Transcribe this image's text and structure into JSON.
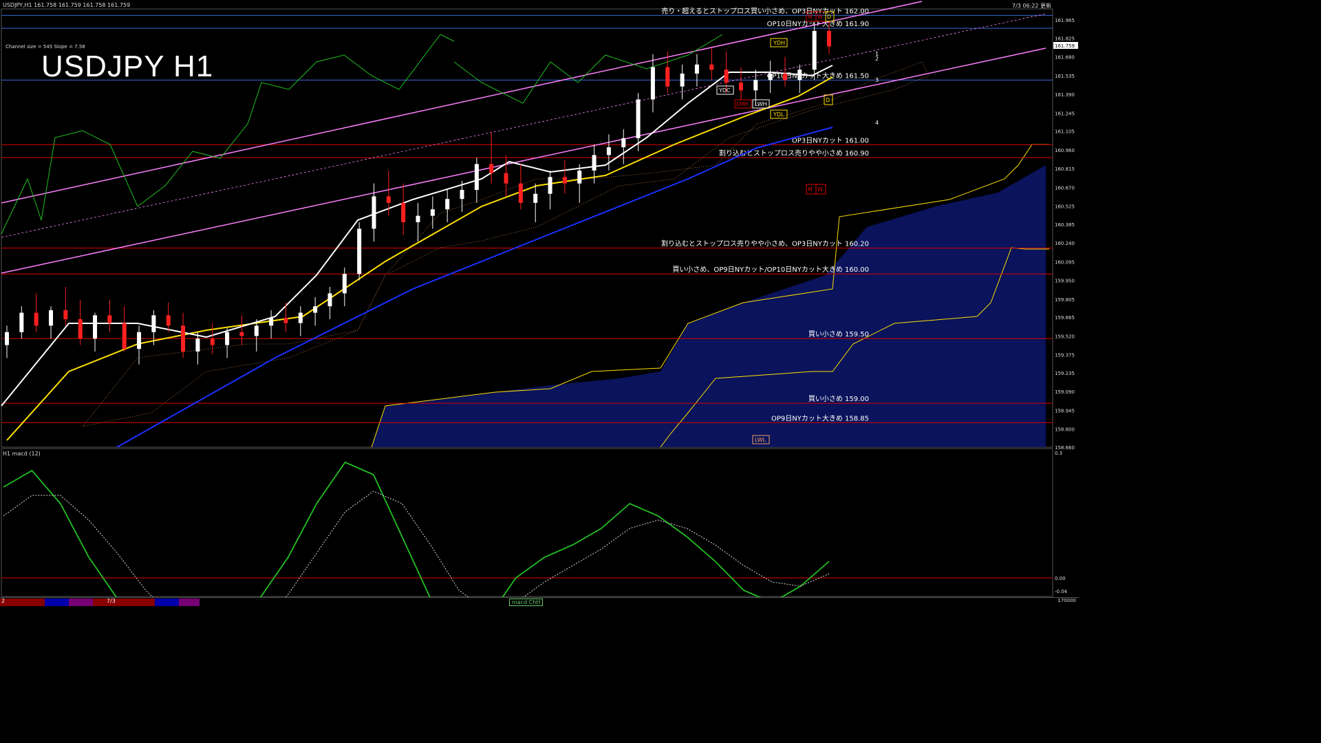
{
  "header": {
    "symbol_info": "USDJPY,H1  161.758 161.759 161.758 161.759",
    "time": "7/3 06:22 更新",
    "title": "USDJPY H1",
    "channel_info": "Channel size = 545 Slope = 7.58"
  },
  "macd_panel": {
    "label": "H1  macd (12)",
    "ticks": [
      "0.3",
      "0.00",
      "-0.04"
    ]
  },
  "footer": {
    "left": "2",
    "date": "7/3",
    "tab": "macd ChH",
    "right": "170000"
  },
  "price_scale": {
    "min": 158.66,
    "max": 162.05,
    "ticks": [
      "161.965",
      "161.825",
      "161.680",
      "161.535",
      "161.390",
      "161.245",
      "161.105",
      "160.960",
      "160.815",
      "160.670",
      "160.525",
      "160.385",
      "160.240",
      "160.095",
      "159.950",
      "159.805",
      "159.665",
      "159.520",
      "159.375",
      "159.235",
      "159.090",
      "158.945",
      "158.800",
      "158.660"
    ],
    "current": "161.759"
  },
  "levels": [
    {
      "price": 162.0,
      "text": "売り・超えるとストップロス買い小さめ、OP3日NYカット 162.00",
      "color": "#3a6ad8"
    },
    {
      "price": 161.9,
      "text": "OP10日NYカット大きめ 161.90",
      "color": "#3a6ad8"
    },
    {
      "price": 161.5,
      "text": "OP10日NYカット大きめ 161.50",
      "color": "#3a6ad8"
    },
    {
      "price": 161.0,
      "text": "OP3日NYカット 161.00",
      "color": "#d00"
    },
    {
      "price": 160.9,
      "text": "割り込むとストップロス売りやや小さめ 160.90",
      "color": "#d00"
    },
    {
      "price": 160.2,
      "text": "割り込むとストップロス売りやや小さめ、OP3日NYカット 160.20",
      "color": "#d00"
    },
    {
      "price": 160.0,
      "text": "買い小さめ、OP9日NYカット/OP10日NYカット大きめ 160.00",
      "color": "#d00"
    },
    {
      "price": 159.5,
      "text": "買い小さめ 159.50",
      "color": "#d00"
    },
    {
      "price": 159.0,
      "text": "買い小さめ 159.00",
      "color": "#d00"
    },
    {
      "price": 158.85,
      "text": "OP9日NYカット大きめ 158.85",
      "color": "#d00"
    }
  ],
  "markers": [
    "YDH",
    "YDC",
    "YDL",
    "LWH",
    "LMH",
    "LWL",
    "M",
    "W",
    "D"
  ],
  "channel_numbers": [
    "1",
    "2",
    "3",
    "4"
  ],
  "colors": {
    "bull": "#ffffff",
    "bear": "#ff2020",
    "tenkan": "#ffffff",
    "sma": "#ffe000",
    "long_ma": "#1a30ff",
    "lagging": "#22c022",
    "channel": "#ff80ff",
    "kumo_blue": "#1a28a0",
    "kumo_orange": "#f0a060",
    "macd_up": "#22c022",
    "macd_down": "#ff8fb0",
    "signal": "#dddddd"
  },
  "chart_data": {
    "type": "candlestick",
    "title": "USDJPY H1",
    "ylim": [
      158.66,
      162.05
    ],
    "candles": [
      [
        159.45,
        159.6,
        159.35,
        159.55
      ],
      [
        159.55,
        159.75,
        159.5,
        159.7
      ],
      [
        159.7,
        159.85,
        159.55,
        159.6
      ],
      [
        159.6,
        159.75,
        159.5,
        159.72
      ],
      [
        159.72,
        159.9,
        159.6,
        159.65
      ],
      [
        159.65,
        159.8,
        159.45,
        159.5
      ],
      [
        159.5,
        159.7,
        159.4,
        159.68
      ],
      [
        159.68,
        159.8,
        159.55,
        159.62
      ],
      [
        159.62,
        159.75,
        159.4,
        159.42
      ],
      [
        159.42,
        159.6,
        159.3,
        159.55
      ],
      [
        159.55,
        159.72,
        159.45,
        159.68
      ],
      [
        159.68,
        159.78,
        159.55,
        159.6
      ],
      [
        159.6,
        159.7,
        159.35,
        159.4
      ],
      [
        159.4,
        159.55,
        159.3,
        159.5
      ],
      [
        159.5,
        159.62,
        159.38,
        159.45
      ],
      [
        159.45,
        159.58,
        159.35,
        159.55
      ],
      [
        159.55,
        159.68,
        159.45,
        159.52
      ],
      [
        159.52,
        159.65,
        159.4,
        159.6
      ],
      [
        159.6,
        159.72,
        159.5,
        159.66
      ],
      [
        159.66,
        159.78,
        159.55,
        159.62
      ],
      [
        159.62,
        159.75,
        159.52,
        159.7
      ],
      [
        159.7,
        159.82,
        159.6,
        159.75
      ],
      [
        159.75,
        159.9,
        159.65,
        159.85
      ],
      [
        159.85,
        160.05,
        159.75,
        160.0
      ],
      [
        160.0,
        160.4,
        159.95,
        160.35
      ],
      [
        160.35,
        160.7,
        160.25,
        160.6
      ],
      [
        160.6,
        160.8,
        160.45,
        160.55
      ],
      [
        160.55,
        160.7,
        160.3,
        160.4
      ],
      [
        160.4,
        160.55,
        160.25,
        160.45
      ],
      [
        160.45,
        160.6,
        160.35,
        160.5
      ],
      [
        160.5,
        160.65,
        160.4,
        160.58
      ],
      [
        160.58,
        160.72,
        160.48,
        160.65
      ],
      [
        160.65,
        160.9,
        160.55,
        160.85
      ],
      [
        160.85,
        161.1,
        160.7,
        160.78
      ],
      [
        160.78,
        160.92,
        160.6,
        160.7
      ],
      [
        160.7,
        160.85,
        160.5,
        160.55
      ],
      [
        160.55,
        160.7,
        160.4,
        160.62
      ],
      [
        160.62,
        160.8,
        160.5,
        160.75
      ],
      [
        160.75,
        160.88,
        160.62,
        160.7
      ],
      [
        160.7,
        160.85,
        160.55,
        160.8
      ],
      [
        160.8,
        161.0,
        160.7,
        160.92
      ],
      [
        160.92,
        161.08,
        160.8,
        160.98
      ],
      [
        160.98,
        161.12,
        160.85,
        161.05
      ],
      [
        161.05,
        161.4,
        160.95,
        161.35
      ],
      [
        161.35,
        161.7,
        161.25,
        161.6
      ],
      [
        161.6,
        161.72,
        161.4,
        161.45
      ],
      [
        161.45,
        161.62,
        161.35,
        161.55
      ],
      [
        161.55,
        161.7,
        161.45,
        161.62
      ],
      [
        161.62,
        161.75,
        161.5,
        161.58
      ],
      [
        161.58,
        161.72,
        161.4,
        161.48
      ],
      [
        161.48,
        161.6,
        161.35,
        161.42
      ],
      [
        161.42,
        161.58,
        161.3,
        161.5
      ],
      [
        161.5,
        161.65,
        161.4,
        161.55
      ],
      [
        161.55,
        161.68,
        161.45,
        161.5
      ],
      [
        161.5,
        161.62,
        161.4,
        161.58
      ],
      [
        161.58,
        161.95,
        161.5,
        161.88
      ],
      [
        161.88,
        161.95,
        161.7,
        161.76
      ]
    ],
    "levels_note": "horizontal price lines",
    "macd": [
      0.22,
      0.26,
      0.18,
      0.05,
      -0.05,
      -0.12,
      -0.18,
      -0.22,
      -0.15,
      -0.05,
      0.05,
      0.18,
      0.28,
      0.25,
      0.1,
      -0.05,
      -0.15,
      -0.1,
      0.0,
      0.05,
      0.08,
      0.12,
      0.18,
      0.15,
      0.1,
      0.04,
      -0.03,
      -0.06,
      -0.02,
      0.04
    ],
    "signal": [
      0.15,
      0.2,
      0.2,
      0.14,
      0.06,
      -0.03,
      -0.1,
      -0.16,
      -0.17,
      -0.12,
      -0.04,
      0.06,
      0.16,
      0.21,
      0.18,
      0.08,
      -0.03,
      -0.08,
      -0.06,
      -0.01,
      0.03,
      0.07,
      0.12,
      0.14,
      0.12,
      0.08,
      0.03,
      -0.01,
      -0.02,
      0.01
    ]
  }
}
